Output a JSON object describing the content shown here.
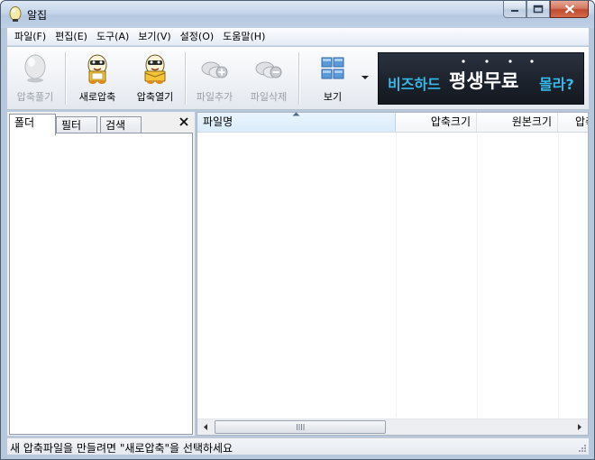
{
  "window": {
    "title": "알집",
    "icon": "egg-icon",
    "controls": [
      "minimize-icon",
      "maximize-icon",
      "close-icon"
    ]
  },
  "menu": [
    {
      "label": "파일(F)"
    },
    {
      "label": "편집(E)"
    },
    {
      "label": "도구(A)"
    },
    {
      "label": "보기(V)"
    },
    {
      "label": "설정(O)"
    },
    {
      "label": "도움말(H)"
    }
  ],
  "toolbar": {
    "buttons": [
      {
        "label": "압축풀기",
        "icon": "egg-icon",
        "enabled": false
      },
      {
        "label": "새로압축",
        "icon": "egg-character-new-icon",
        "enabled": true
      },
      {
        "label": "압축열기",
        "icon": "egg-character-open-icon",
        "enabled": true
      },
      {
        "label": "파일추가",
        "icon": "add-file-icon",
        "enabled": false
      },
      {
        "label": "파일삭제",
        "icon": "delete-file-icon",
        "enabled": false
      },
      {
        "label": "보기",
        "icon": "view-grid-icon",
        "enabled": true
      }
    ],
    "view_dropdown_icon": "dropdown-arrow-icon"
  },
  "banner": {
    "part1": "비즈하드",
    "part2": "평생무료",
    "part3": "몰라?"
  },
  "left_panel": {
    "tabs": [
      {
        "label": "폴더",
        "active": true
      },
      {
        "label": "필터",
        "active": false
      },
      {
        "label": "검색",
        "active": false
      }
    ],
    "close_label": "✕"
  },
  "file_list": {
    "columns": [
      {
        "label": "파일명",
        "sorted": true
      },
      {
        "label": "압축크기"
      },
      {
        "label": "원본크기"
      },
      {
        "label": "압축"
      }
    ],
    "rows": []
  },
  "status": {
    "text": "새 압축파일을 만들려면 \"새로압축\"을 선택하세요"
  },
  "colors": {
    "banner_accent": "#37b9ea",
    "banner_bg": "#1b212b",
    "disabled_text": "#9aa0a8"
  }
}
